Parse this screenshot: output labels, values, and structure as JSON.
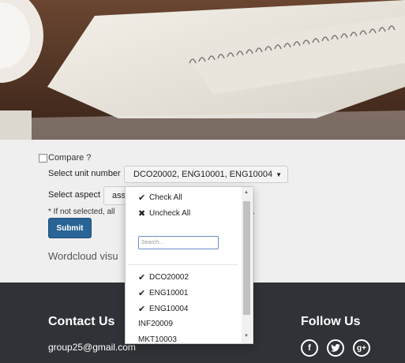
{
  "form": {
    "compare_label": "Compare ?",
    "unit_label": "Select unit number",
    "unit_selected": "DCO20002, ENG10001, ENG10004",
    "aspect_label": "Select aspect",
    "aspect_value": "ass",
    "note": "* If not selected, all",
    "note_tail": ".",
    "submit_label": "Submit",
    "wordcloud": "Wordcloud visu"
  },
  "dropdown": {
    "check_all": "Check All",
    "uncheck_all": "Uncheck All",
    "search_placeholder": "Search...",
    "options": [
      {
        "label": "DCO20002",
        "checked": true
      },
      {
        "label": "ENG10001",
        "checked": true
      },
      {
        "label": "ENG10004",
        "checked": true
      },
      {
        "label": "INF20009",
        "checked": false
      },
      {
        "label": "MKT10003",
        "checked": false
      }
    ]
  },
  "footer": {
    "contact_title": "Contact Us",
    "email": "group25@gmail.com",
    "follow_title": "Follow Us",
    "social": [
      "facebook-icon",
      "twitter-icon",
      "google-plus-icon"
    ]
  },
  "colors": {
    "submit": "#2a6496",
    "footer_bg": "#2f3337",
    "form_bg": "#efefef"
  }
}
